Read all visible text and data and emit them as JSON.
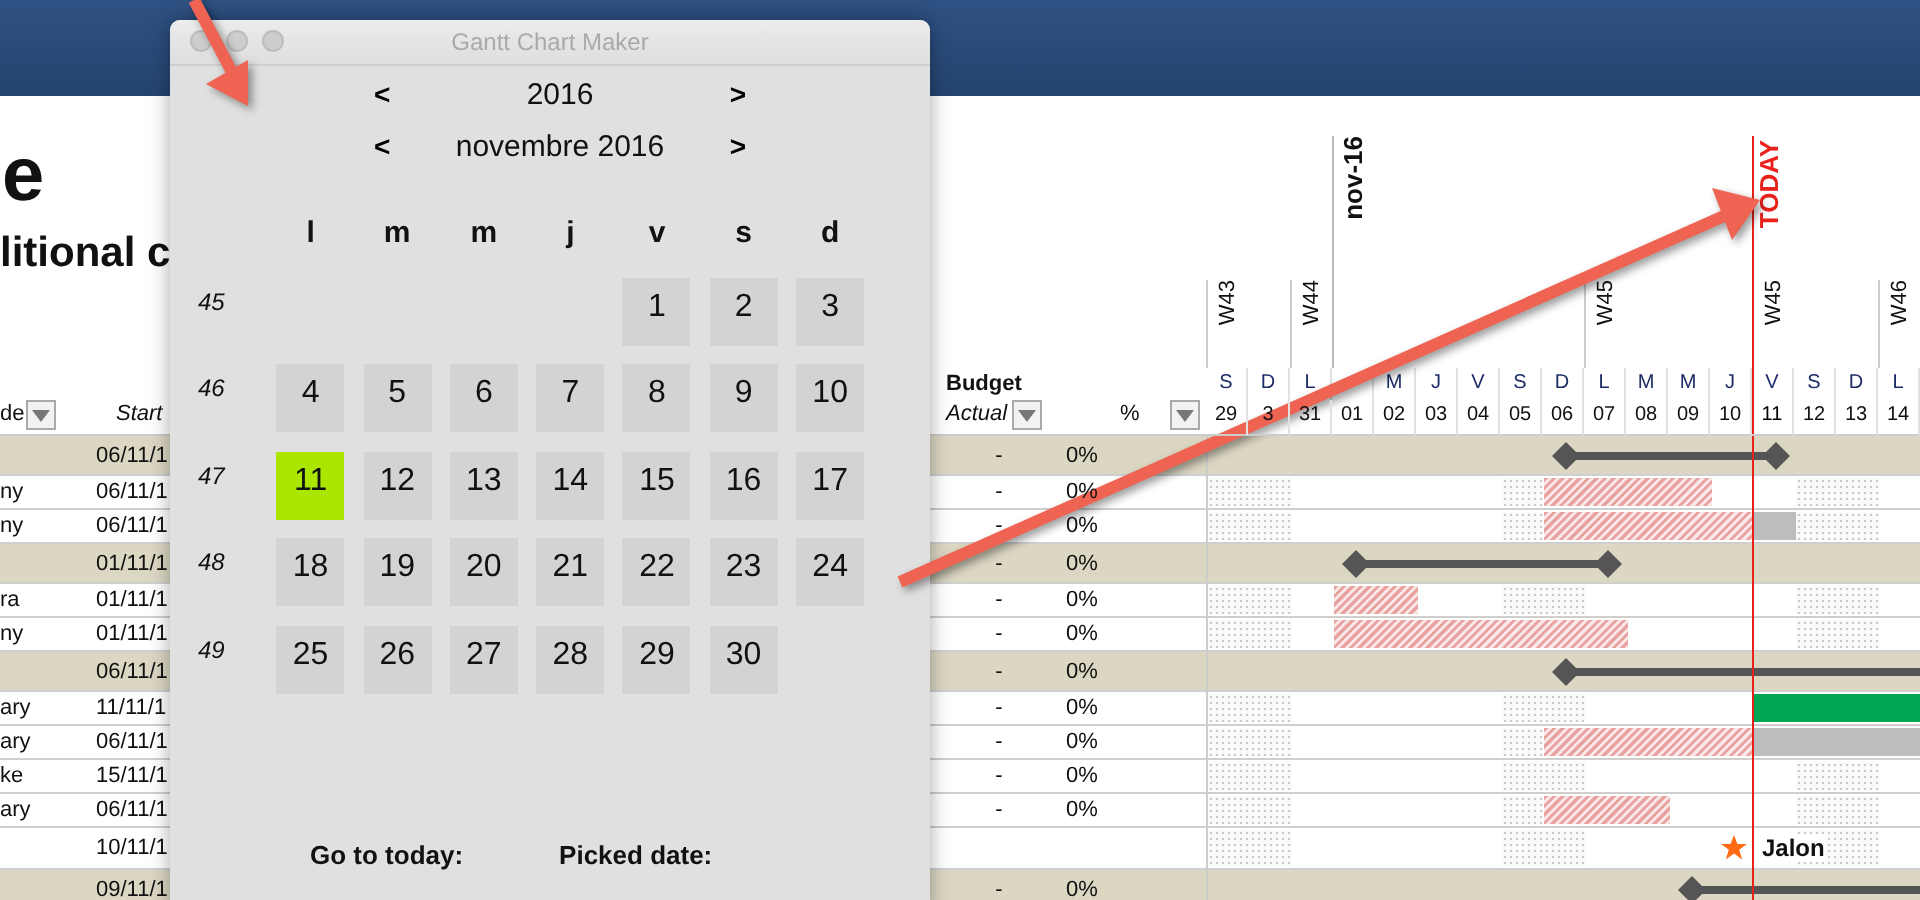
{
  "page": {
    "title": "e",
    "subtitle": "litional c"
  },
  "columns": {
    "leader": "de",
    "start": "Start",
    "budget": "Budget",
    "actual": "Actual",
    "percent": "%"
  },
  "timeline": {
    "today_label": "TODAY",
    "days": [
      {
        "dow": "S",
        "day": "29",
        "week": "W43",
        "today": false
      },
      {
        "dow": "D",
        "day": "3",
        "today": false
      },
      {
        "dow": "L",
        "day": "31",
        "week": "W44",
        "today": false
      },
      {
        "day": "01",
        "month": "nov-16",
        "today": false
      },
      {
        "dow": "M",
        "day": "02",
        "today": false
      },
      {
        "dow": "J",
        "day": "03",
        "today": false
      },
      {
        "dow": "V",
        "day": "04",
        "today": false
      },
      {
        "dow": "S",
        "day": "05",
        "today": false
      },
      {
        "dow": "D",
        "day": "06",
        "today": false
      },
      {
        "dow": "L",
        "day": "07",
        "week": "W45",
        "today": false
      },
      {
        "dow": "M",
        "day": "08",
        "today": false
      },
      {
        "dow": "M",
        "day": "09",
        "today": false
      },
      {
        "dow": "J",
        "day": "10",
        "today": false
      },
      {
        "dow": "V",
        "day": "11",
        "week": "W45",
        "today": true
      },
      {
        "dow": "S",
        "day": "12",
        "today": false
      },
      {
        "dow": "D",
        "day": "13",
        "today": false
      },
      {
        "dow": "L",
        "day": "14",
        "week": "W46",
        "today": false
      }
    ]
  },
  "rows": [
    {
      "kind": "summary",
      "start": "06/11/1",
      "budget": "-",
      "percent": "0%",
      "days": [
        {
          "kind": "blank"
        },
        {
          "kind": "blank"
        },
        {
          "kind": "blank"
        },
        {
          "kind": "blank"
        },
        {
          "kind": "blank"
        },
        {
          "kind": "blank"
        },
        {
          "kind": "blank"
        },
        {
          "kind": "blank"
        },
        {
          "kind": "bar_start"
        },
        {
          "kind": "bar"
        },
        {
          "kind": "bar"
        },
        {
          "kind": "bar"
        },
        {
          "kind": "bar"
        },
        {
          "kind": "bar_end"
        },
        {
          "kind": "blank"
        },
        {
          "kind": "blank"
        },
        {
          "kind": "blank"
        }
      ]
    },
    {
      "kind": "task",
      "leader": "ny",
      "start": "06/11/1",
      "budget": "-",
      "percent": "0%",
      "days": [
        {
          "kind": "weekend"
        },
        {
          "kind": "weekend"
        },
        {
          "kind": "blank"
        },
        {
          "kind": "blank"
        },
        {
          "kind": "blank"
        },
        {
          "kind": "blank"
        },
        {
          "kind": "blank"
        },
        {
          "kind": "weekend"
        },
        {
          "kind": "planned"
        },
        {
          "kind": "planned"
        },
        {
          "kind": "planned"
        },
        {
          "kind": "planned"
        },
        {
          "kind": "blank"
        },
        {
          "kind": "blank"
        },
        {
          "kind": "weekend"
        },
        {
          "kind": "weekend"
        },
        {
          "kind": "blank"
        }
      ]
    },
    {
      "kind": "task",
      "leader": "ny",
      "start": "06/11/1",
      "budget": "-",
      "percent": "0%",
      "days": [
        {
          "kind": "weekend"
        },
        {
          "kind": "weekend"
        },
        {
          "kind": "blank"
        },
        {
          "kind": "blank"
        },
        {
          "kind": "blank"
        },
        {
          "kind": "blank"
        },
        {
          "kind": "blank"
        },
        {
          "kind": "weekend"
        },
        {
          "kind": "planned"
        },
        {
          "kind": "planned"
        },
        {
          "kind": "planned"
        },
        {
          "kind": "planned"
        },
        {
          "kind": "planned"
        },
        {
          "kind": "overdue"
        },
        {
          "kind": "weekend"
        },
        {
          "kind": "weekend"
        },
        {
          "kind": "blank"
        }
      ]
    },
    {
      "kind": "summary",
      "start": "01/11/1",
      "budget": "-",
      "percent": "0%",
      "days": [
        {
          "kind": "blank"
        },
        {
          "kind": "blank"
        },
        {
          "kind": "blank"
        },
        {
          "kind": "bar_start"
        },
        {
          "kind": "bar"
        },
        {
          "kind": "bar"
        },
        {
          "kind": "bar"
        },
        {
          "kind": "bar"
        },
        {
          "kind": "bar"
        },
        {
          "kind": "bar_end"
        },
        {
          "kind": "blank"
        },
        {
          "kind": "blank"
        },
        {
          "kind": "blank"
        },
        {
          "kind": "blank"
        },
        {
          "kind": "blank"
        },
        {
          "kind": "blank"
        },
        {
          "kind": "blank"
        }
      ]
    },
    {
      "kind": "task",
      "leader": "ra",
      "start": "01/11/1",
      "budget": "-",
      "percent": "0%",
      "days": [
        {
          "kind": "weekend"
        },
        {
          "kind": "weekend"
        },
        {
          "kind": "blank"
        },
        {
          "kind": "planned"
        },
        {
          "kind": "planned"
        },
        {
          "kind": "blank"
        },
        {
          "kind": "blank"
        },
        {
          "kind": "weekend"
        },
        {
          "kind": "weekend"
        },
        {
          "kind": "blank"
        },
        {
          "kind": "blank"
        },
        {
          "kind": "blank"
        },
        {
          "kind": "blank"
        },
        {
          "kind": "blank"
        },
        {
          "kind": "weekend"
        },
        {
          "kind": "weekend"
        },
        {
          "kind": "blank"
        }
      ]
    },
    {
      "kind": "task",
      "leader": "ny",
      "start": "01/11/1",
      "budget": "-",
      "percent": "0%",
      "days": [
        {
          "kind": "weekend"
        },
        {
          "kind": "weekend"
        },
        {
          "kind": "blank"
        },
        {
          "kind": "planned"
        },
        {
          "kind": "planned"
        },
        {
          "kind": "planned"
        },
        {
          "kind": "planned"
        },
        {
          "kind": "planned"
        },
        {
          "kind": "planned"
        },
        {
          "kind": "planned"
        },
        {
          "kind": "blank"
        },
        {
          "kind": "blank"
        },
        {
          "kind": "blank"
        },
        {
          "kind": "blank"
        },
        {
          "kind": "weekend"
        },
        {
          "kind": "weekend"
        },
        {
          "kind": "blank"
        }
      ]
    },
    {
      "kind": "summary",
      "start": "06/11/1",
      "budget": "-",
      "percent": "0%",
      "days": [
        {
          "kind": "blank"
        },
        {
          "kind": "blank"
        },
        {
          "kind": "blank"
        },
        {
          "kind": "blank"
        },
        {
          "kind": "blank"
        },
        {
          "kind": "blank"
        },
        {
          "kind": "blank"
        },
        {
          "kind": "blank"
        },
        {
          "kind": "bar_start"
        },
        {
          "kind": "bar"
        },
        {
          "kind": "bar"
        },
        {
          "kind": "bar"
        },
        {
          "kind": "bar"
        },
        {
          "kind": "bar"
        },
        {
          "kind": "bar"
        },
        {
          "kind": "bar"
        },
        {
          "kind": "bar"
        }
      ]
    },
    {
      "kind": "task",
      "leader": "ary",
      "start": "11/11/1",
      "budget": "-",
      "percent": "0%",
      "days": [
        {
          "kind": "weekend"
        },
        {
          "kind": "weekend"
        },
        {
          "kind": "blank"
        },
        {
          "kind": "blank"
        },
        {
          "kind": "blank"
        },
        {
          "kind": "blank"
        },
        {
          "kind": "blank"
        },
        {
          "kind": "weekend"
        },
        {
          "kind": "weekend"
        },
        {
          "kind": "blank"
        },
        {
          "kind": "blank"
        },
        {
          "kind": "blank"
        },
        {
          "kind": "blank"
        },
        {
          "kind": "done"
        },
        {
          "kind": "done"
        },
        {
          "kind": "done"
        },
        {
          "kind": "done"
        }
      ]
    },
    {
      "kind": "task",
      "leader": "ary",
      "start": "06/11/1",
      "budget": "-",
      "percent": "0%",
      "days": [
        {
          "kind": "weekend"
        },
        {
          "kind": "weekend"
        },
        {
          "kind": "blank"
        },
        {
          "kind": "blank"
        },
        {
          "kind": "blank"
        },
        {
          "kind": "blank"
        },
        {
          "kind": "blank"
        },
        {
          "kind": "weekend"
        },
        {
          "kind": "planned"
        },
        {
          "kind": "planned"
        },
        {
          "kind": "planned"
        },
        {
          "kind": "planned"
        },
        {
          "kind": "planned"
        },
        {
          "kind": "overdue"
        },
        {
          "kind": "overdue"
        },
        {
          "kind": "overdue"
        },
        {
          "kind": "overdue"
        }
      ]
    },
    {
      "kind": "task",
      "leader": "ke",
      "start": "15/11/1",
      "budget": "-",
      "percent": "0%",
      "days": [
        {
          "kind": "weekend"
        },
        {
          "kind": "weekend"
        },
        {
          "kind": "blank"
        },
        {
          "kind": "blank"
        },
        {
          "kind": "blank"
        },
        {
          "kind": "blank"
        },
        {
          "kind": "blank"
        },
        {
          "kind": "weekend"
        },
        {
          "kind": "weekend"
        },
        {
          "kind": "blank"
        },
        {
          "kind": "blank"
        },
        {
          "kind": "blank"
        },
        {
          "kind": "blank"
        },
        {
          "kind": "blank"
        },
        {
          "kind": "weekend"
        },
        {
          "kind": "weekend"
        },
        {
          "kind": "blank"
        }
      ]
    },
    {
      "kind": "task",
      "leader": "ary",
      "start": "06/11/1",
      "budget": "-",
      "percent": "0%",
      "days": [
        {
          "kind": "weekend"
        },
        {
          "kind": "weekend"
        },
        {
          "kind": "blank"
        },
        {
          "kind": "blank"
        },
        {
          "kind": "blank"
        },
        {
          "kind": "blank"
        },
        {
          "kind": "blank"
        },
        {
          "kind": "weekend"
        },
        {
          "kind": "planned"
        },
        {
          "kind": "planned"
        },
        {
          "kind": "planned"
        },
        {
          "kind": "blank"
        },
        {
          "kind": "blank"
        },
        {
          "kind": "blank"
        },
        {
          "kind": "weekend"
        },
        {
          "kind": "weekend"
        },
        {
          "kind": "blank"
        }
      ]
    },
    {
      "kind": "milestone",
      "start": "10/11/1",
      "label": "Jalon",
      "days": [
        {
          "kind": "weekend"
        },
        {
          "kind": "weekend"
        },
        {
          "kind": "blank"
        },
        {
          "kind": "blank"
        },
        {
          "kind": "blank"
        },
        {
          "kind": "blank"
        },
        {
          "kind": "blank"
        },
        {
          "kind": "weekend"
        },
        {
          "kind": "weekend"
        },
        {
          "kind": "blank"
        },
        {
          "kind": "blank"
        },
        {
          "kind": "blank"
        },
        {
          "kind": "milestone"
        },
        {
          "kind": "blank"
        },
        {
          "kind": "weekend"
        },
        {
          "kind": "weekend"
        },
        {
          "kind": "blank"
        }
      ]
    },
    {
      "kind": "summary",
      "start": "09/11/1",
      "budget": "-",
      "percent": "0%",
      "days": [
        {
          "kind": "blank"
        },
        {
          "kind": "blank"
        },
        {
          "kind": "blank"
        },
        {
          "kind": "blank"
        },
        {
          "kind": "blank"
        },
        {
          "kind": "blank"
        },
        {
          "kind": "blank"
        },
        {
          "kind": "blank"
        },
        {
          "kind": "blank"
        },
        {
          "kind": "blank"
        },
        {
          "kind": "blank"
        },
        {
          "kind": "bar_start"
        },
        {
          "kind": "bar"
        },
        {
          "kind": "bar"
        },
        {
          "kind": "bar"
        },
        {
          "kind": "bar"
        },
        {
          "kind": "bar"
        }
      ]
    }
  ],
  "dialog": {
    "title": "Gantt Chart Maker",
    "prev": "<",
    "next": ">",
    "year": "2016",
    "month": "novembre 2016",
    "weekdays": [
      "l",
      "m",
      "m",
      "j",
      "v",
      "s",
      "d"
    ],
    "weeks": [
      {
        "number": "45",
        "days": [
          {
            "kind": "blank"
          },
          {
            "kind": "blank"
          },
          {
            "kind": "blank"
          },
          {
            "kind": "blank"
          },
          {
            "kind": "day",
            "label": "1",
            "selected": false
          },
          {
            "kind": "day",
            "label": "2",
            "selected": false
          },
          {
            "kind": "day",
            "label": "3",
            "selected": false
          }
        ]
      },
      {
        "number": "46",
        "days": [
          {
            "kind": "day",
            "label": "4",
            "selected": false
          },
          {
            "kind": "day",
            "label": "5",
            "selected": false
          },
          {
            "kind": "day",
            "label": "6",
            "selected": false
          },
          {
            "kind": "day",
            "label": "7",
            "selected": false
          },
          {
            "kind": "day",
            "label": "8",
            "selected": false
          },
          {
            "kind": "day",
            "label": "9",
            "selected": false
          },
          {
            "kind": "day",
            "label": "10",
            "selected": false
          }
        ]
      },
      {
        "number": "47",
        "days": [
          {
            "kind": "day",
            "label": "11",
            "selected": true
          },
          {
            "kind": "day",
            "label": "12",
            "selected": false
          },
          {
            "kind": "day",
            "label": "13",
            "selected": false
          },
          {
            "kind": "day",
            "label": "14",
            "selected": false
          },
          {
            "kind": "day",
            "label": "15",
            "selected": false
          },
          {
            "kind": "day",
            "label": "16",
            "selected": false
          },
          {
            "kind": "day",
            "label": "17",
            "selected": false
          }
        ]
      },
      {
        "number": "48",
        "days": [
          {
            "kind": "day",
            "label": "18",
            "selected": false
          },
          {
            "kind": "day",
            "label": "19",
            "selected": false
          },
          {
            "kind": "day",
            "label": "20",
            "selected": false
          },
          {
            "kind": "day",
            "label": "21",
            "selected": false
          },
          {
            "kind": "day",
            "label": "22",
            "selected": false
          },
          {
            "kind": "day",
            "label": "23",
            "selected": false
          },
          {
            "kind": "day",
            "label": "24",
            "selected": false
          }
        ]
      },
      {
        "number": "49",
        "days": [
          {
            "kind": "day",
            "label": "25",
            "selected": false
          },
          {
            "kind": "day",
            "label": "26",
            "selected": false
          },
          {
            "kind": "day",
            "label": "27",
            "selected": false
          },
          {
            "kind": "day",
            "label": "28",
            "selected": false
          },
          {
            "kind": "day",
            "label": "29",
            "selected": false
          },
          {
            "kind": "day",
            "label": "30",
            "selected": false
          },
          {
            "kind": "blank"
          }
        ]
      }
    ],
    "go_today": "Go to today:",
    "picked": "Picked date:"
  }
}
